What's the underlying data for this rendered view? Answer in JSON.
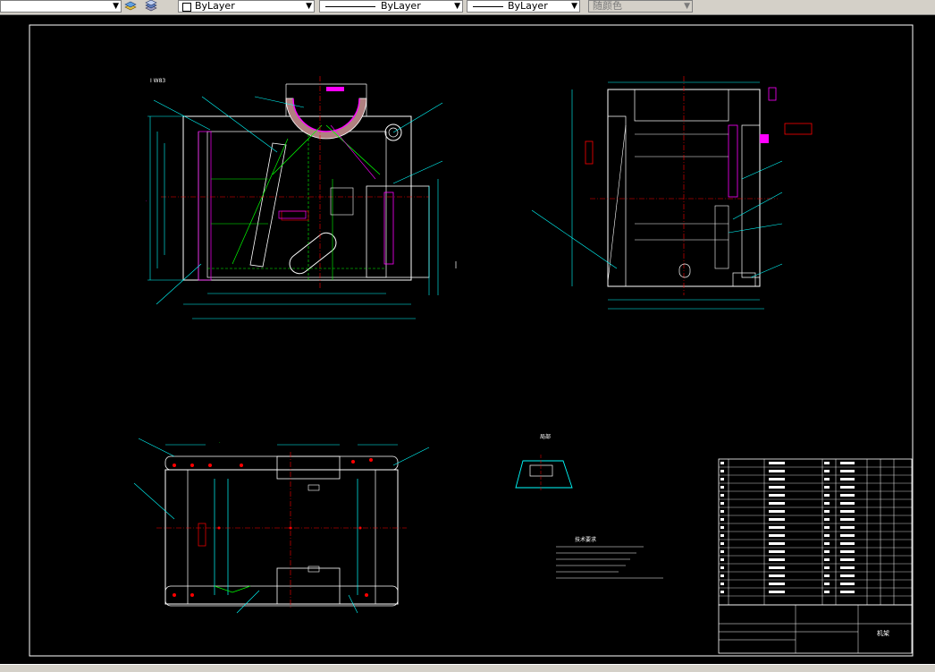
{
  "toolbar": {
    "layer_combo_arrow": "▼",
    "color_label": "ByLayer",
    "linetype_label": "ByLayer",
    "lineweight_label": "ByLayer",
    "plotstyle_label": "随颜色"
  },
  "colors": {
    "background": "#000000",
    "frame": "#ffffff",
    "geometry": "#ffffff",
    "dimension": "#00ffff",
    "hatch_text": "#ff00ff",
    "centerline": "#ff0000",
    "green": "#00ff00",
    "yellow": "#ffff00"
  },
  "drawing": {
    "notes_title": "技术要求",
    "title_block_name": "机架",
    "detail_label": "局部"
  }
}
